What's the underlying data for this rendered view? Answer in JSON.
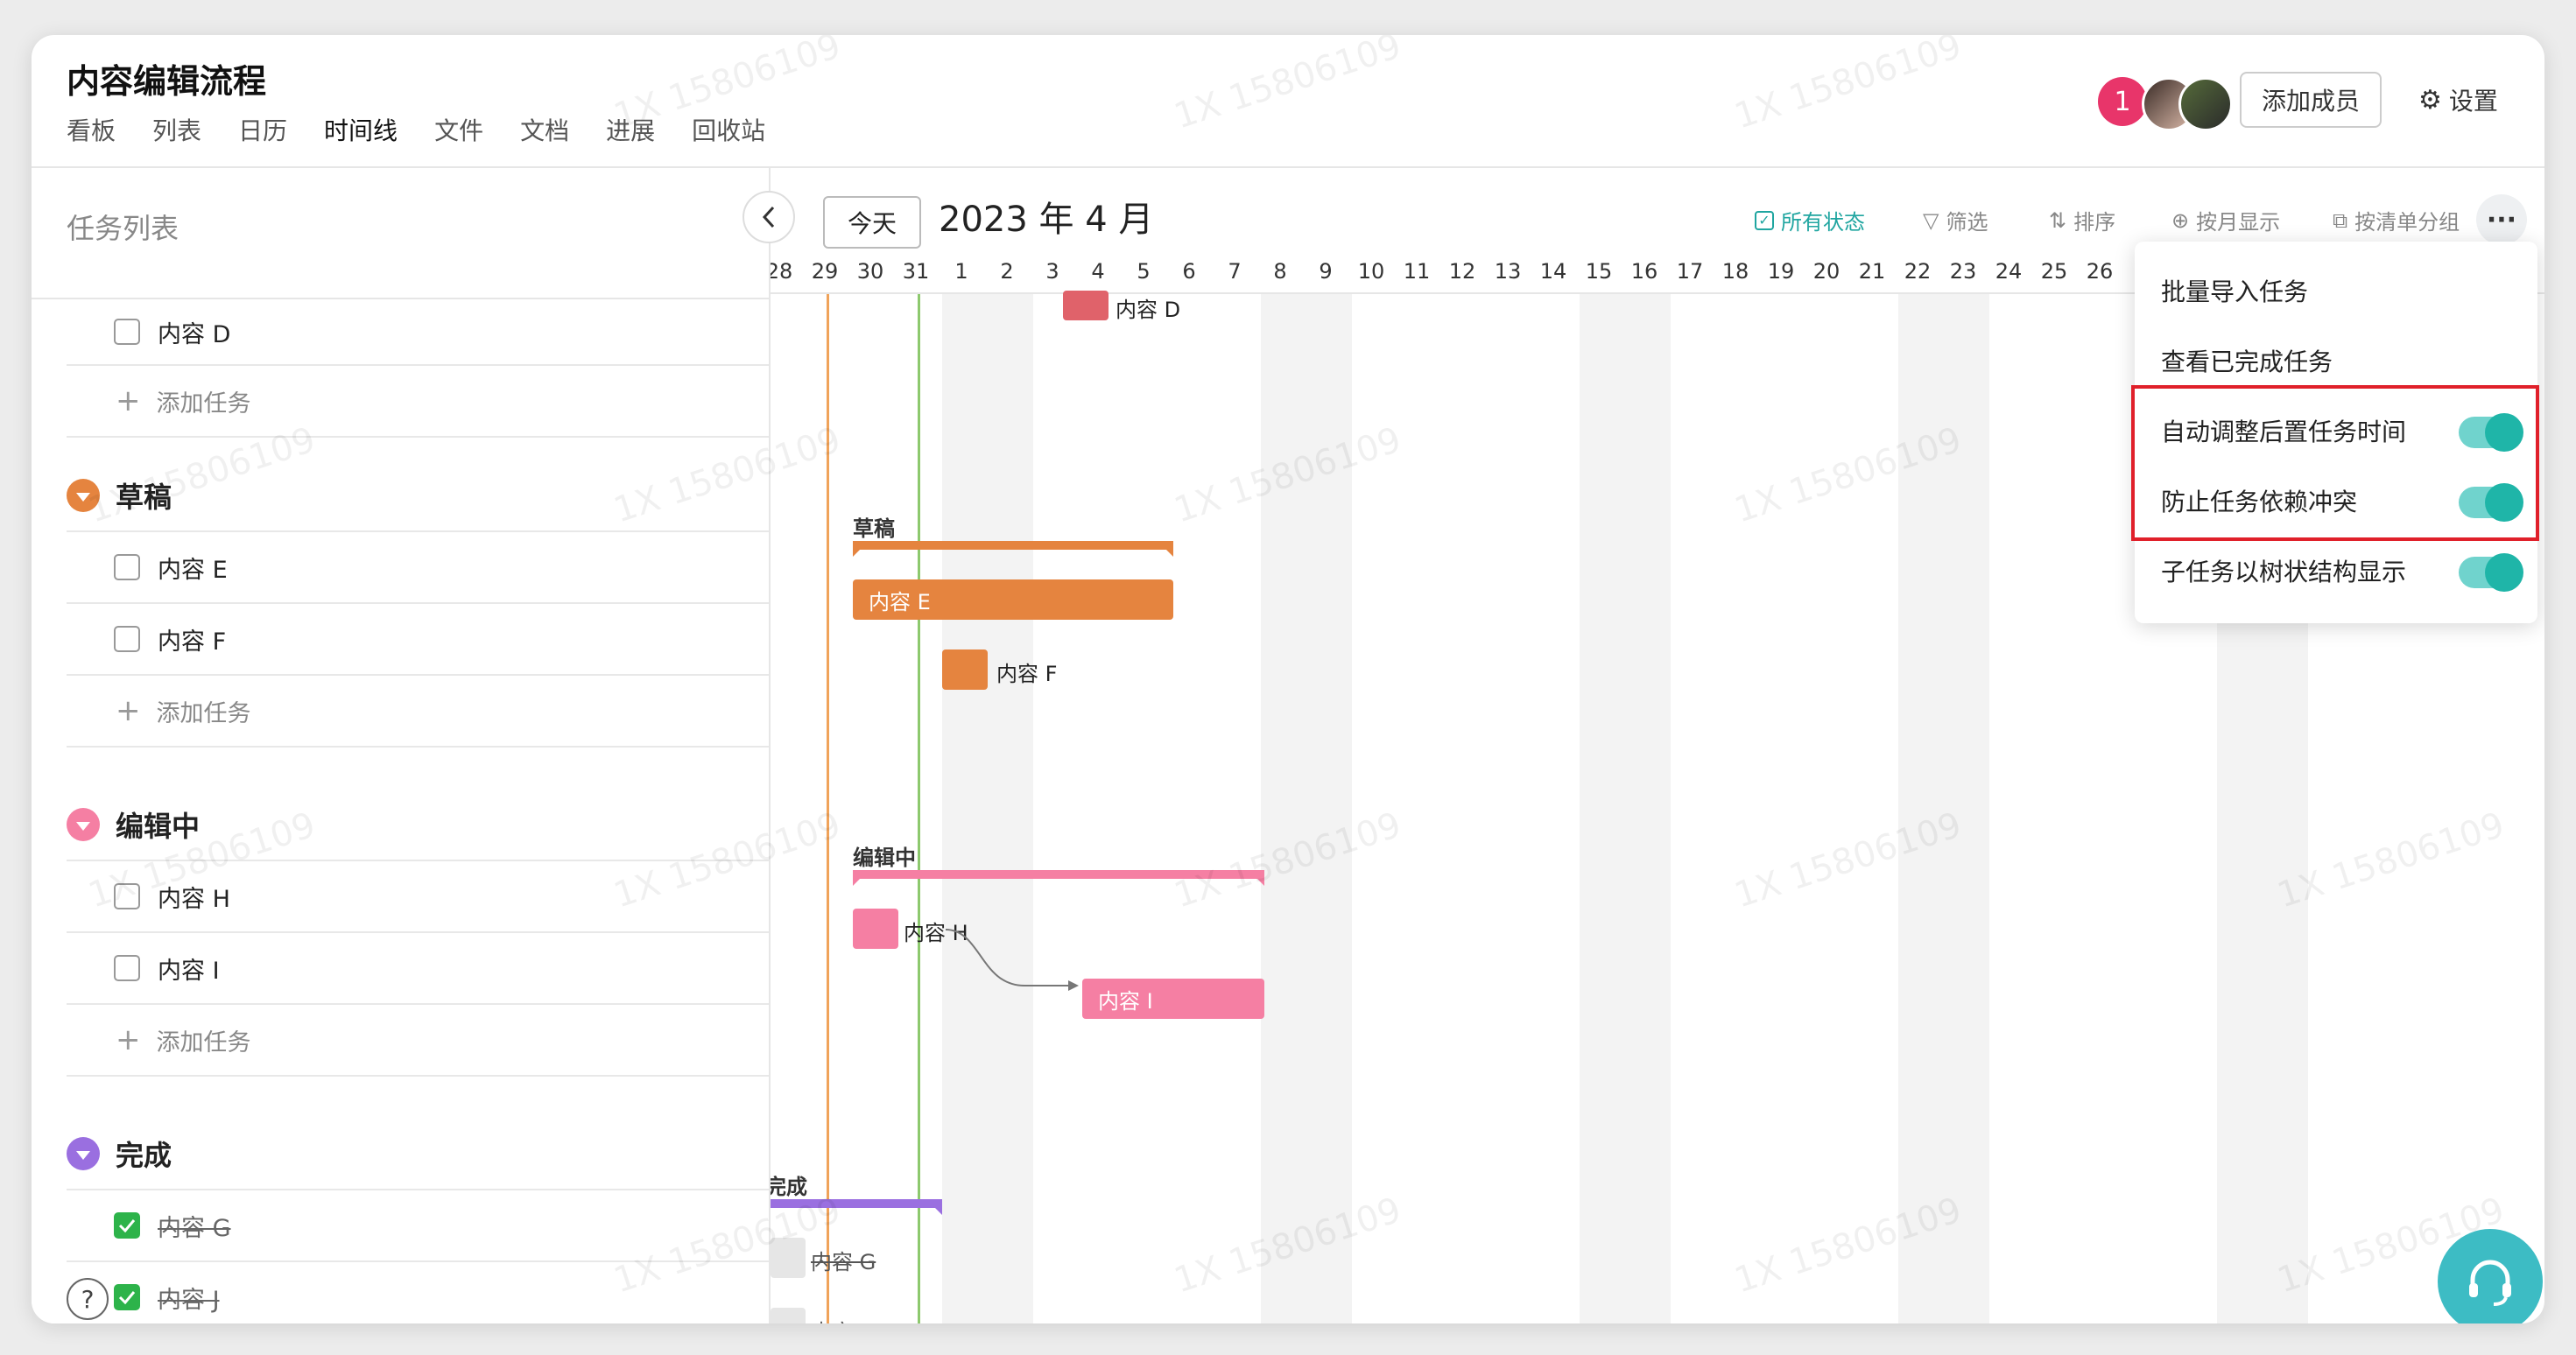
{
  "header": {
    "title": "内容编辑流程",
    "tabs": [
      "看板",
      "列表",
      "日历",
      "时间线",
      "文件",
      "文档",
      "进展",
      "回收站"
    ],
    "active_tab": "时间线",
    "member_count": "1",
    "add_member_label": "添加成员",
    "settings_label": "设置"
  },
  "sidebar": {
    "title": "任务列表",
    "add_task_label": "添加任务",
    "groups": [
      {
        "name": "草稿",
        "color": "#e5843f"
      },
      {
        "name": "编辑中",
        "color": "#f57fa3"
      },
      {
        "name": "完成",
        "color": "#9a6fe0"
      }
    ],
    "tasks": {
      "d": "内容 D",
      "e": "内容 E",
      "f": "内容 F",
      "h": "内容 H",
      "i": "内容 I",
      "g": "内容 G",
      "j": "内容 J"
    }
  },
  "timeline": {
    "today_label": "今天",
    "month": "2023 年 4 月",
    "tools": {
      "status": "所有状态",
      "filter": "筛选",
      "sort": "排序",
      "by_month": "按月显示",
      "group_by_list": "按清单分组"
    },
    "days": [
      "28",
      "29",
      "30",
      "31",
      "1",
      "2",
      "3",
      "4",
      "5",
      "6",
      "7",
      "8",
      "9",
      "10",
      "11",
      "12",
      "13",
      "14",
      "15",
      "16",
      "17",
      "18",
      "19",
      "20",
      "21",
      "22",
      "23",
      "24",
      "25",
      "26"
    ],
    "group_labels": {
      "draft": "草稿",
      "editing": "编辑中",
      "done": "完成"
    },
    "bars": {
      "d": "内容 D",
      "e": "内容 E",
      "f": "内容 F",
      "h": "内容 H",
      "i": "内容 I",
      "g": "内容 G",
      "j": "内容 J"
    }
  },
  "menu": {
    "items": [
      {
        "label": "批量导入任务"
      },
      {
        "label": "查看已完成任务"
      },
      {
        "label": "自动调整后置任务时间",
        "toggle": true
      },
      {
        "label": "防止任务依赖冲突",
        "toggle": true
      },
      {
        "label": "子任务以树状结构显示",
        "toggle": true
      }
    ]
  },
  "watermark": "1X 15806109",
  "colors": {
    "accent": "#1fa5a0",
    "draft": "#e5843f",
    "editing": "#f57fa3",
    "done": "#9a6fe0",
    "content_d": "#e0626a",
    "today_line": "#f0a35a",
    "now_line": "#8dc96e",
    "highlight": "#e0202a"
  }
}
